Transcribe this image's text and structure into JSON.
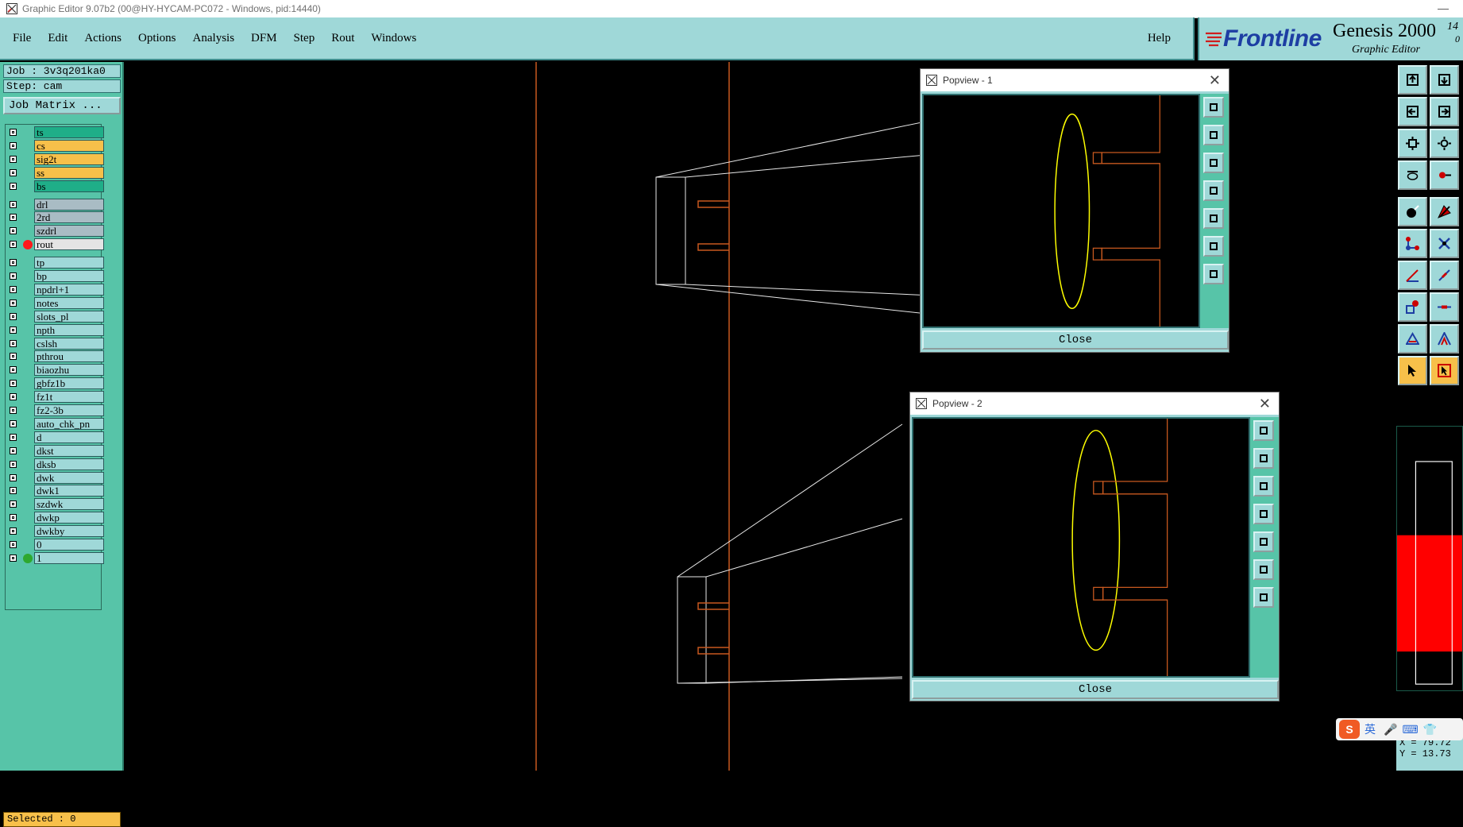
{
  "window": {
    "title": "Graphic Editor 9.07b2 (00@HY-HYCAM-PC072 - Windows, pid:14440)",
    "minimize_glyph": "—"
  },
  "menubar": {
    "items": [
      "File",
      "Edit",
      "Actions",
      "Options",
      "Analysis",
      "DFM",
      "Step",
      "Rout",
      "Windows"
    ],
    "help": "Help"
  },
  "brand": {
    "logo": "Frontline",
    "product": "Genesis 2000",
    "subtitle": "Graphic Editor",
    "version": "14",
    "version_sub": "0"
  },
  "left_panel": {
    "job": "Job : 3v3q201ka0",
    "step": "Step: cam",
    "job_matrix": "Job Matrix ...",
    "layers": [
      {
        "name": "ts",
        "color": "#1fae88",
        "active": false
      },
      {
        "name": "cs",
        "color": "#f7c04a",
        "active": false
      },
      {
        "name": "sig2t",
        "color": "#f7c04a",
        "active": false
      },
      {
        "name": "ss",
        "color": "#f7c04a",
        "active": false
      },
      {
        "name": "bs",
        "color": "#1fae88",
        "active": false
      },
      {
        "name": "drl",
        "color": "#a9bcc4",
        "active": false
      },
      {
        "name": "2rd",
        "color": "#a9bcc4",
        "active": false
      },
      {
        "name": "szdrl",
        "color": "#a9bcc4",
        "active": false
      },
      {
        "name": "rout",
        "color": "#e4e4e4",
        "active": true,
        "dot": "#ff1a1a"
      },
      {
        "name": "tp",
        "color": "#9fd8d8",
        "active": false
      },
      {
        "name": "bp",
        "color": "#9fd8d8",
        "active": false
      },
      {
        "name": "npdrl+1",
        "color": "#9fd8d8",
        "active": false
      },
      {
        "name": "notes",
        "color": "#9fd8d8",
        "active": false
      },
      {
        "name": "slots_pl",
        "color": "#9fd8d8",
        "active": false
      },
      {
        "name": "npth",
        "color": "#9fd8d8",
        "active": false
      },
      {
        "name": "cslsh",
        "color": "#9fd8d8",
        "active": false
      },
      {
        "name": "pthrou",
        "color": "#9fd8d8",
        "active": false
      },
      {
        "name": "biaozhu",
        "color": "#9fd8d8",
        "active": false
      },
      {
        "name": "gbfz1b",
        "color": "#9fd8d8",
        "active": false
      },
      {
        "name": "fz1t",
        "color": "#9fd8d8",
        "active": false
      },
      {
        "name": "fz2-3b",
        "color": "#9fd8d8",
        "active": false
      },
      {
        "name": "auto_chk_pn",
        "color": "#9fd8d8",
        "active": false
      },
      {
        "name": "d",
        "color": "#9fd8d8",
        "active": false
      },
      {
        "name": "dkst",
        "color": "#9fd8d8",
        "active": false
      },
      {
        "name": "dksb",
        "color": "#9fd8d8",
        "active": false
      },
      {
        "name": "dwk",
        "color": "#9fd8d8",
        "active": false
      },
      {
        "name": "dwk1",
        "color": "#9fd8d8",
        "active": false
      },
      {
        "name": "szdwk",
        "color": "#9fd8d8",
        "active": false
      },
      {
        "name": "dwkp",
        "color": "#9fd8d8",
        "active": false
      },
      {
        "name": "dwkby",
        "color": "#9fd8d8",
        "active": false
      },
      {
        "name": "0",
        "color": "#9fd8d8",
        "active": false
      },
      {
        "name": "1",
        "color": "#9fd8d8",
        "active": true,
        "dot": "#2ea82e"
      }
    ],
    "selected": "Selected : 0"
  },
  "popview1": {
    "title": "Popview - 1",
    "close_label": "Close"
  },
  "popview2": {
    "title": "Popview - 2",
    "close_label": "Close"
  },
  "coords": {
    "x": "X = 79.72",
    "y": "Y = 13.73"
  },
  "ime": {
    "logo": "S",
    "lang": "英"
  }
}
